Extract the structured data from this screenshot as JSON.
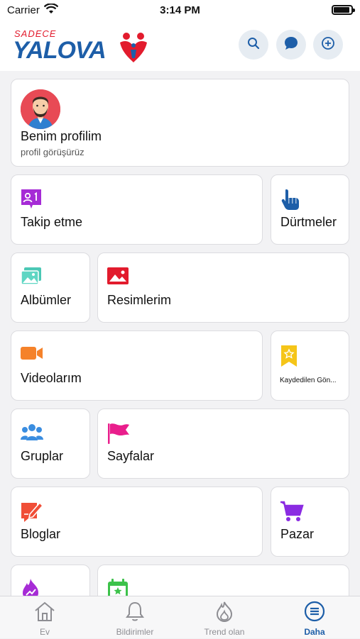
{
  "status": {
    "carrier": "Carrier",
    "time": "3:14 PM"
  },
  "logo": {
    "small": "SADECE",
    "big": "YALOVA"
  },
  "header": {
    "icons": [
      "search-icon",
      "chat-icon",
      "add-circle-icon"
    ]
  },
  "profile": {
    "name": "Benim profilim",
    "subtitle": "profil görüşürüz"
  },
  "tiles": {
    "follow": "Takip etme",
    "pokes": "Dürtmeler",
    "albums": "Albümler",
    "photos": "Resimlerim",
    "videos": "Videolarım",
    "saved": "Kaydedilen Gön...",
    "groups": "Gruplar",
    "pages": "Sayfalar",
    "blogs": "Bloglar",
    "market": "Pazar"
  },
  "tabs": {
    "home": "Ev",
    "notifications": "Bildirimler",
    "trending": "Trend olan",
    "more": "Daha"
  },
  "colors": {
    "accent": "#1d5ea8",
    "brand_red": "#e21b2d"
  }
}
